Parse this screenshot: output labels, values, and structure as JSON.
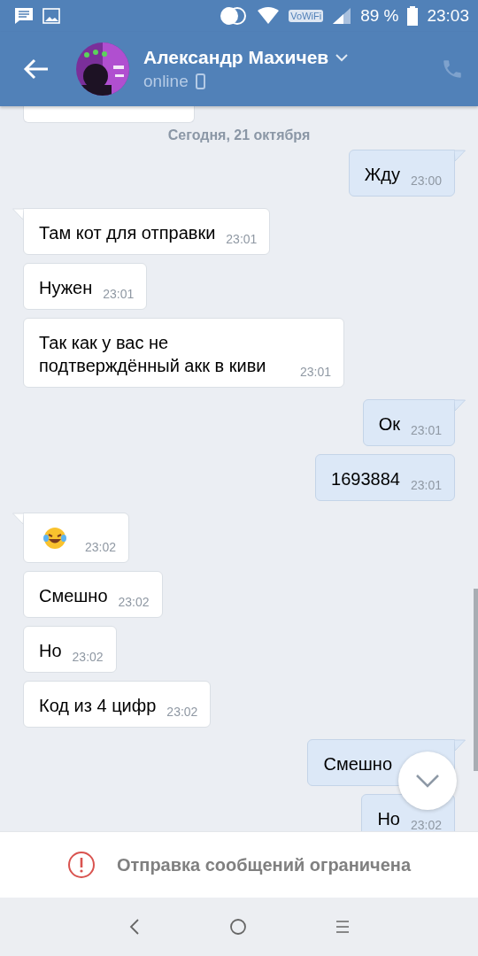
{
  "status_bar": {
    "battery": "89 %",
    "time": "23:03",
    "wifi_label": "VoWiFi"
  },
  "header": {
    "name": "Александр Махичев",
    "status": "online"
  },
  "date_divider": "Сегодня, 21 октября",
  "messages": [
    {
      "kind": "cut",
      "outgoing": false
    },
    {
      "kind": "text",
      "outgoing": true,
      "tail": true,
      "text": "Жду",
      "time": "23:00"
    },
    {
      "kind": "text",
      "outgoing": false,
      "tail": true,
      "text": "Там кот для отправки",
      "time": "23:01"
    },
    {
      "kind": "text",
      "outgoing": false,
      "tail": false,
      "text": "Нужен",
      "time": "23:01"
    },
    {
      "kind": "text",
      "outgoing": false,
      "tail": false,
      "text": "Так как у вас не подтверждённый акк в киви",
      "time": "23:01"
    },
    {
      "kind": "text",
      "outgoing": true,
      "tail": true,
      "text": "Ок",
      "time": "23:01"
    },
    {
      "kind": "text",
      "outgoing": true,
      "tail": false,
      "text": "1693884",
      "time": "23:01"
    },
    {
      "kind": "emoji",
      "outgoing": false,
      "tail": true,
      "time": "23:02"
    },
    {
      "kind": "text",
      "outgoing": false,
      "tail": false,
      "text": "Смешно",
      "time": "23:02"
    },
    {
      "kind": "text",
      "outgoing": false,
      "tail": false,
      "text": "Но",
      "time": "23:02"
    },
    {
      "kind": "text",
      "outgoing": false,
      "tail": false,
      "text": "Код из 4 цифр",
      "time": "23:02"
    },
    {
      "kind": "text",
      "outgoing": true,
      "tail": true,
      "text": "Смешно"
    },
    {
      "kind": "text",
      "outgoing": true,
      "tail": false,
      "text": "Но",
      "time": "23:02"
    }
  ],
  "notice": "Отправка сообщений ограничена"
}
